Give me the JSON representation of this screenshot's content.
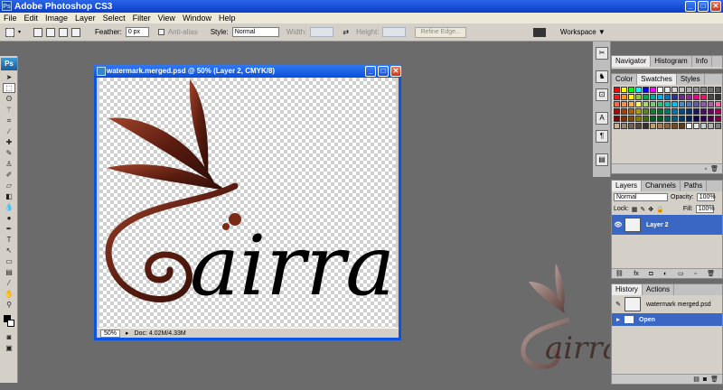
{
  "app": {
    "title": "Adobe Photoshop CS3",
    "icon_text": "Ps"
  },
  "window_buttons": {
    "minimize": "_",
    "maximize": "□",
    "close": "✕"
  },
  "menu": [
    "File",
    "Edit",
    "Image",
    "Layer",
    "Select",
    "Filter",
    "View",
    "Window",
    "Help"
  ],
  "options": {
    "feather_label": "Feather:",
    "feather_value": "0 px",
    "antialias_label": "Anti-alias",
    "style_label": "Style:",
    "style_value": "Normal",
    "width_label": "Width:",
    "height_label": "Height:",
    "refine_label": "Refine Edge...",
    "workspace_label": "Workspace ▼"
  },
  "toolbox": {
    "logo": "Ps",
    "tools": [
      "marquee-icon",
      "lasso-icon",
      "magic-wand-icon",
      "crop-icon",
      "slice-icon",
      "healing-brush-icon",
      "brush-icon",
      "clone-stamp-icon",
      "history-brush-icon",
      "eraser-icon",
      "gradient-icon",
      "blur-icon",
      "dodge-icon",
      "pen-icon",
      "type-icon",
      "path-select-icon",
      "shape-icon",
      "notes-icon",
      "eyedropper-icon",
      "hand-icon",
      "zoom-icon"
    ]
  },
  "document": {
    "title": "watermark.merged.psd @ 50% (Layer 2, CMYK/8)",
    "zoom": "50%",
    "doc_size": "Doc: 4.02M/4.33M",
    "artwork_text": "airra"
  },
  "navigator_panel": {
    "tabs": [
      "Navigator",
      "Histogram",
      "Info"
    ]
  },
  "swatches_panel": {
    "tabs": [
      "Color",
      "Swatches",
      "Styles"
    ],
    "colors": [
      "#ff0000",
      "#ffff00",
      "#00ff00",
      "#00ffff",
      "#0000ff",
      "#ff00ff",
      "#ffffff",
      "#ebebeb",
      "#d6d6d6",
      "#c2c2c2",
      "#adadad",
      "#999999",
      "#858585",
      "#707070",
      "#5c5c5c",
      "#ed1c24",
      "#f7941d",
      "#fff200",
      "#8dc63f",
      "#00a651",
      "#00a99d",
      "#00aeef",
      "#0072bc",
      "#2e3192",
      "#662d91",
      "#92278f",
      "#ec008c",
      "#ed145b",
      "#474747",
      "#333333",
      "#f26c4f",
      "#f68e56",
      "#fbaf5d",
      "#fff568",
      "#acd373",
      "#7cc576",
      "#3bb878",
      "#1abbb4",
      "#00bff3",
      "#438ccb",
      "#5674b9",
      "#605ca8",
      "#855fa8",
      "#a763a8",
      "#f06eaa",
      "#9e0b0f",
      "#a0410d",
      "#a3620a",
      "#aba000",
      "#598527",
      "#197b30",
      "#007236",
      "#00746b",
      "#0076a3",
      "#004b80",
      "#003471",
      "#1b1464",
      "#440e62",
      "#630460",
      "#9e005d",
      "#790000",
      "#7b2e00",
      "#7d4900",
      "#827b00",
      "#406618",
      "#005e20",
      "#005826",
      "#005952",
      "#005b7f",
      "#003663",
      "#002157",
      "#0d004c",
      "#32004b",
      "#4b0049",
      "#7b0046",
      "#c7b299",
      "#998675",
      "#736357",
      "#534741",
      "#37302a",
      "#c69c6d",
      "#a67c52",
      "#8c6239",
      "#754c24",
      "#603913",
      "#ffffff",
      "#e6e6e6",
      "#cccccc",
      "#b3b3b3",
      "#808080"
    ]
  },
  "layers_panel": {
    "tabs": [
      "Layers",
      "Channels",
      "Paths"
    ],
    "blend_mode": "Normal",
    "opacity_label": "Opacity:",
    "opacity_value": "100%",
    "lock_label": "Lock:",
    "fill_label": "Fill:",
    "fill_value": "100%",
    "layer_name": "Layer 2"
  },
  "history_panel": {
    "tabs": [
      "History",
      "Actions"
    ],
    "snapshot": "watermark merged.psd",
    "step": "Open"
  }
}
